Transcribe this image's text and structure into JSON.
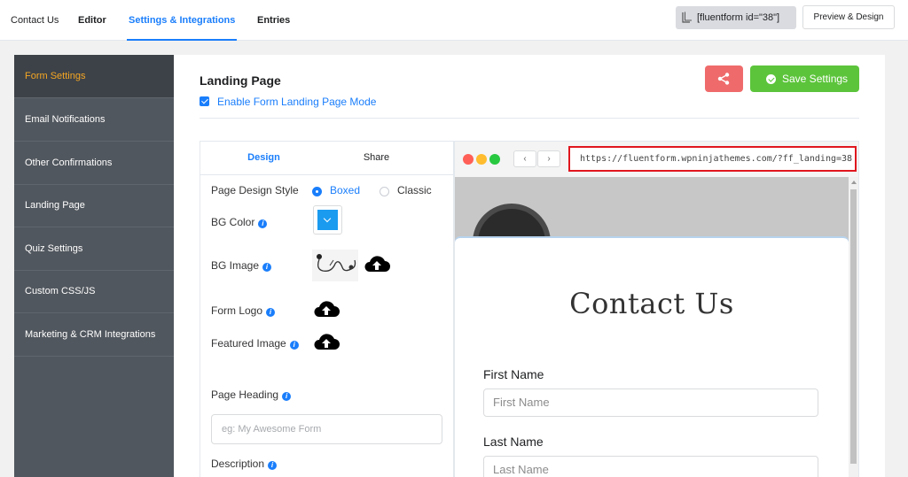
{
  "topnav": {
    "tabs": [
      {
        "label": "Contact Us"
      },
      {
        "label": "Editor"
      },
      {
        "label": "Settings & Integrations"
      },
      {
        "label": "Entries"
      }
    ],
    "shortcode": "[fluentform id=\"38\"]",
    "preview_button": "Preview & Design"
  },
  "sidebar": {
    "items": [
      {
        "label": "Form Settings"
      },
      {
        "label": "Email Notifications"
      },
      {
        "label": "Other Confirmations"
      },
      {
        "label": "Landing Page"
      },
      {
        "label": "Quiz Settings"
      },
      {
        "label": "Custom CSS/JS"
      },
      {
        "label": "Marketing & CRM Integrations"
      }
    ]
  },
  "main": {
    "title": "Landing Page",
    "enable_label": "Enable Form Landing Page Mode",
    "save_label": "Save Settings"
  },
  "settings": {
    "tabs": [
      {
        "label": "Design"
      },
      {
        "label": "Share"
      }
    ],
    "page_design_style_label": "Page Design Style",
    "style_options": [
      {
        "label": "Boxed",
        "selected": true
      },
      {
        "label": "Classic",
        "selected": false
      }
    ],
    "bg_color_label": "BG Color",
    "bg_color_value": "#1a9bf0",
    "bg_image_label": "BG Image",
    "form_logo_label": "Form Logo",
    "featured_image_label": "Featured Image",
    "page_heading_label": "Page Heading",
    "page_heading_placeholder": "eg: My Awesome Form",
    "description_label": "Description"
  },
  "preview": {
    "url": "https://fluentform.wpninjathemes.com/?ff_landing=38",
    "form_title": "Contact Us",
    "fields": [
      {
        "label": "First Name",
        "placeholder": "First Name"
      },
      {
        "label": "Last Name",
        "placeholder": "Last Name"
      }
    ]
  },
  "colors": {
    "accent": "#1a7efb",
    "save": "#5cc43b",
    "share": "#ef6b6b",
    "url_highlight": "#e0161e",
    "sidebar_active_text": "#f5a623"
  }
}
